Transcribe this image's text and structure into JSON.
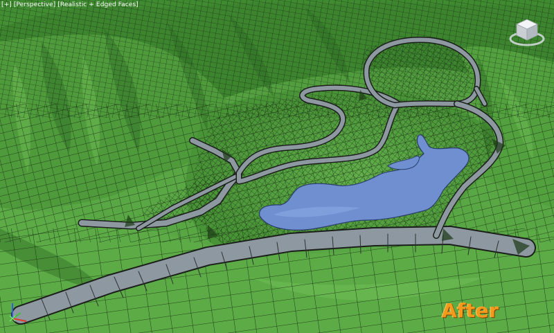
{
  "viewport": {
    "label_parts": [
      "[+]",
      "[Perspective]",
      "[Realistic + Edged Faces]"
    ],
    "view_name": "Perspective",
    "shading_mode": "Realistic + Edged Faces"
  },
  "gizmos": {
    "viewcube_icon": "viewcube-icon",
    "axis_icon": "xyz-axis-tripod-icon"
  },
  "caption": {
    "text": "After"
  },
  "colors": {
    "terrain_green": "#4d9a3a",
    "terrain_light": "#6fbf52",
    "terrain_dark": "#2f6a22",
    "wire": "#0d1a0a",
    "road": "#8e98a0",
    "water": "#6f8fd0",
    "caption": "#f39a1c"
  }
}
